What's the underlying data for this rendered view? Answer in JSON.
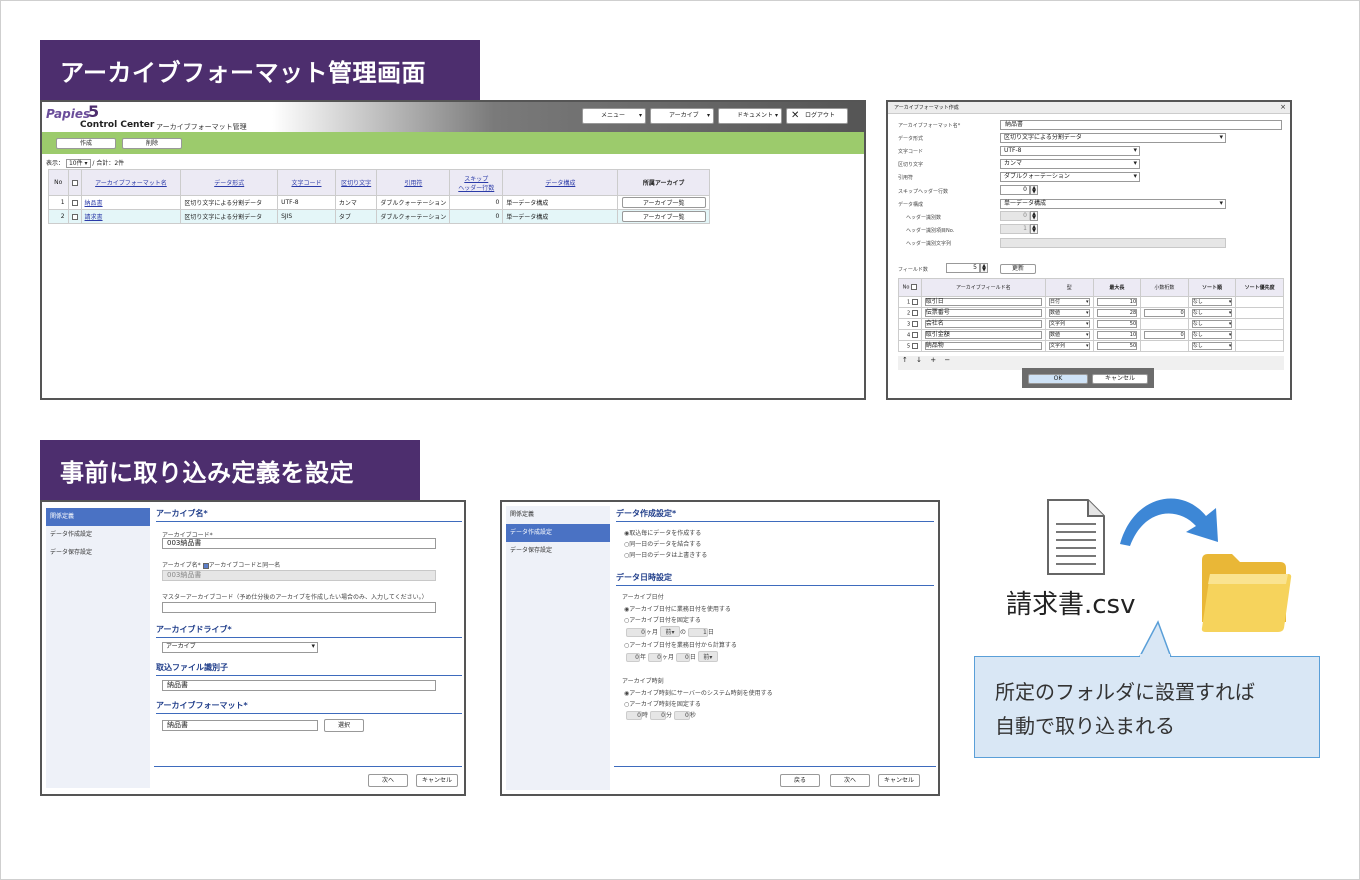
{
  "banners": {
    "top": "アーカイブフォーマット管理画面",
    "bottom": "事前に取り込み定義を設定"
  },
  "app": {
    "logo_top": "Papies",
    "logo_num": "5",
    "logo_bottom": "Control Center",
    "page_title": "アーカイブフォーマット管理",
    "menu": [
      "メニュー",
      "アーカイブ",
      "ドキュメント",
      "ログアウト"
    ],
    "actions": {
      "create": "作成",
      "delete": "削除"
    },
    "paging": {
      "display": "表示：",
      "per_page": "10件",
      "total": "/ 合計：2件"
    },
    "columns": [
      "No",
      "アーカイブフォーマット名",
      "データ形式",
      "文字コード",
      "区切り文字",
      "引用符",
      "スキップ",
      "ヘッダー行数",
      "データ構成",
      "所属アーカイブ"
    ],
    "rows": [
      {
        "no": "1",
        "name": "納品書",
        "format": "区切り文字による分割データ",
        "encoding": "UTF-8",
        "delimiter": "カンマ",
        "quote": "ダブルクォーテーション",
        "skip": "0",
        "structure": "単一データ構成",
        "archive": "アーカイブ一覧"
      },
      {
        "no": "2",
        "name": "請求書",
        "format": "区切り文字による分割データ",
        "encoding": "SJIS",
        "delimiter": "タブ",
        "quote": "ダブルクォーテーション",
        "skip": "0",
        "structure": "単一データ構成",
        "archive": "アーカイブ一覧"
      }
    ]
  },
  "dialog": {
    "title": "アーカイブフォーマット作成",
    "close": "×",
    "labels": [
      "アーカイブフォーマット名*",
      "データ形式",
      "文字コード",
      "区切り文字",
      "引用符",
      "スキップヘッダー行数",
      "データ構成",
      "ヘッダー識別数",
      "ヘッダー識別項目No.",
      "ヘッダー識別文字列"
    ],
    "values": {
      "name": "納品書",
      "format": "区切り文字による分割データ",
      "encoding": "UTF-8",
      "delimiter": "カンマ",
      "quote": "ダブルクォーテーション",
      "skip": "0",
      "structure": "単一データ構成",
      "hdr_count": "0",
      "hdr_no": "1"
    },
    "field_count_label": "フィールド数",
    "field_count": "5",
    "update": "更新",
    "columns": [
      "No",
      "アーカイブフィールド名",
      "型",
      "最大長",
      "小数桁数",
      "ソート順",
      "ソート優先度"
    ],
    "fields": [
      {
        "no": "1",
        "name": "取引日",
        "type": "日付",
        "len": "10",
        "dec": "",
        "sort": "なし"
      },
      {
        "no": "2",
        "name": "伝票番号",
        "type": "数値",
        "len": "28",
        "dec": "0",
        "sort": "なし"
      },
      {
        "no": "3",
        "name": "会社名",
        "type": "文字列",
        "len": "50",
        "dec": "",
        "sort": "なし"
      },
      {
        "no": "4",
        "name": "取引金額",
        "type": "数値",
        "len": "10",
        "dec": "0",
        "sort": "なし"
      },
      {
        "no": "5",
        "name": "納品物",
        "type": "文字列",
        "len": "50",
        "dec": "",
        "sort": "なし"
      }
    ],
    "tools": [
      "↑",
      "↓",
      "+",
      "−"
    ],
    "ok": "OK",
    "cancel": "キャンセル"
  },
  "form1": {
    "side": [
      "関係定義",
      "データ作成設定",
      "データ保存設定"
    ],
    "sec_name": "アーカイブ名*",
    "code_label": "アーカイブコード*",
    "code": "003納品書",
    "name_label": "アーカイブ名*",
    "same_label": "アーカイブコードと同一名",
    "name": "003納品書",
    "master_label": "マスターアーカイブコード（予め仕分後のアーカイブを作成したい場合のみ、入力してください。）",
    "sec_drive": "アーカイブドライブ*",
    "drive": "アーカイブ",
    "sec_ident": "取込ファイル識別子",
    "ident": "納品書",
    "sec_format": "アーカイブフォーマット*",
    "format": "納品書",
    "select": "選択",
    "next": "次へ",
    "cancel": "キャンセル"
  },
  "form2": {
    "side": [
      "関係定義",
      "データ作成設定",
      "データ保存設定"
    ],
    "sec_create": "データ作成設定*",
    "opt_create": [
      "取込毎にデータを作成する",
      "同一日のデータを結合する",
      "同一日のデータは上書きする"
    ],
    "sec_date": "データ日時設定",
    "date_label": "アーカイブ日付",
    "opt_date": [
      "アーカイブ日付に業務日付を使用する",
      "アーカイブ日付を固定する",
      "アーカイブ日付を業務日付から計算する"
    ],
    "d1": {
      "a": "0",
      "u1": "ヶ月",
      "s": "前",
      "b": "1",
      "u2": "日"
    },
    "d2": {
      "a": "0",
      "u1": "年",
      "b": "0",
      "u2": "ヶ月",
      "c": "0",
      "u3": "日",
      "s": "前"
    },
    "time_label": "アーカイブ時刻",
    "opt_time": [
      "アーカイブ時刻にサーバーのシステム時刻を使用する",
      "アーカイブ時刻を固定する"
    ],
    "t": {
      "h": "0",
      "hu": "時",
      "m": "0",
      "mu": "分",
      "s": "0",
      "su": "秒"
    },
    "back": "戻る",
    "next": "次へ",
    "cancel": "キャンセル"
  },
  "illustration": {
    "file": "請求書.csv",
    "callout_line1": "所定のフォルダに設置すれば",
    "callout_line2": "自動で取り込まれる"
  },
  "colors": {
    "banner": "#4d2e6e",
    "green": "#9ccb6c",
    "blue": "#4a72c4",
    "callout": "#d9e7f5"
  }
}
